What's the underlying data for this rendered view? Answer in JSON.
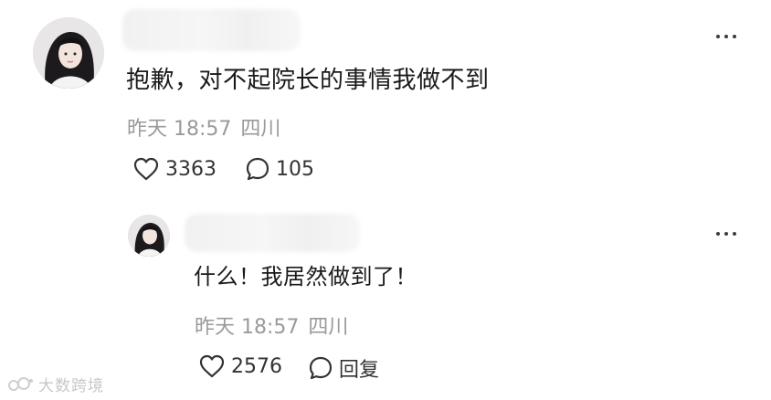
{
  "comment": {
    "text": "抱歉，对不起院长的事情我做不到",
    "time": "昨天 18:57",
    "location": "四川",
    "likes": "3363",
    "replies": "105"
  },
  "reply": {
    "text": "什么！我居然做到了！",
    "time": "昨天 18:57",
    "location": "四川",
    "likes": "2576",
    "reply_label": "回复"
  },
  "watermark": {
    "text": "大数跨境"
  },
  "icons": {
    "more": "more-dots-icon",
    "like": "heart-outline-icon",
    "comment": "speech-bubble-icon",
    "logo": "brand-logo-icon"
  },
  "colors": {
    "text": "#1a1a1a",
    "meta": "#9a9a9a",
    "icon": "#333333",
    "background": "#ffffff"
  }
}
